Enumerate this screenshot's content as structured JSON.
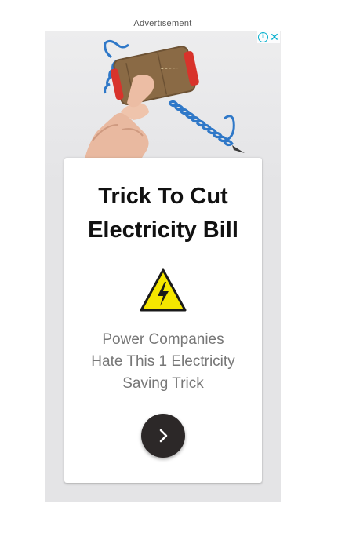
{
  "ad": {
    "label": "Advertisement",
    "headline_lines": [
      "Trick To Cut",
      "Electricity Bill"
    ],
    "body_lines": [
      "Power Companies",
      "Hate This 1 Electricity",
      "Saving Trick"
    ],
    "info_glyph": "i",
    "close_glyph": "✕"
  },
  "icons": {
    "adchoices_info": "info-icon",
    "adchoices_close": "close-icon",
    "warning": "high-voltage-warning-icon",
    "cta": "chevron-right-icon"
  },
  "colors": {
    "adchoices": "#00aecd",
    "cta_background": "#2c2828",
    "warning_fill": "#f5e600",
    "headline": "#111111",
    "body_text": "#777777"
  }
}
